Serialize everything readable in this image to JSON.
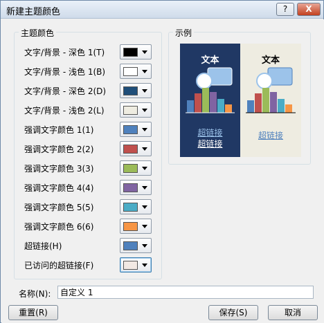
{
  "window": {
    "title": "新建主题颜色",
    "help_label": "?",
    "close_label": "X"
  },
  "theme_colors": {
    "group_title": "主题颜色",
    "rows": [
      {
        "label": "文字/背景 - 深色 1(T)",
        "color": "#000000"
      },
      {
        "label": "文字/背景 - 浅色 1(B)",
        "color": "#ffffff"
      },
      {
        "label": "文字/背景 - 深色 2(D)",
        "color": "#1f4e79"
      },
      {
        "label": "文字/背景 - 浅色 2(L)",
        "color": "#eeece1"
      },
      {
        "label": "强调文字颜色 1(1)",
        "color": "#4f81bd"
      },
      {
        "label": "强调文字颜色 2(2)",
        "color": "#c0504d"
      },
      {
        "label": "强调文字颜色 3(3)",
        "color": "#9bbb59"
      },
      {
        "label": "强调文字颜色 4(4)",
        "color": "#8064a2"
      },
      {
        "label": "强调文字颜色 5(5)",
        "color": "#4bacc6"
      },
      {
        "label": "强调文字颜色 6(6)",
        "color": "#f79646"
      },
      {
        "label": "超链接(H)",
        "color": "#4f81bd"
      },
      {
        "label": "已访问的超链接(F)",
        "color": "#f2e9e4"
      }
    ]
  },
  "sample": {
    "group_title": "示例",
    "dark_panel": {
      "heading": "文本",
      "link": "超链接",
      "visited_link": "超链接"
    },
    "light_panel": {
      "heading": "文本",
      "link": "超链接"
    },
    "bar_colors": [
      "#4f81bd",
      "#c0504d",
      "#9bbb59",
      "#8064a2",
      "#4bacc6",
      "#f79646"
    ]
  },
  "name_field": {
    "label": "名称(N):",
    "value": "自定义 1"
  },
  "buttons": {
    "reset": "重置(R)",
    "save": "保存(S)",
    "cancel": "取消"
  }
}
